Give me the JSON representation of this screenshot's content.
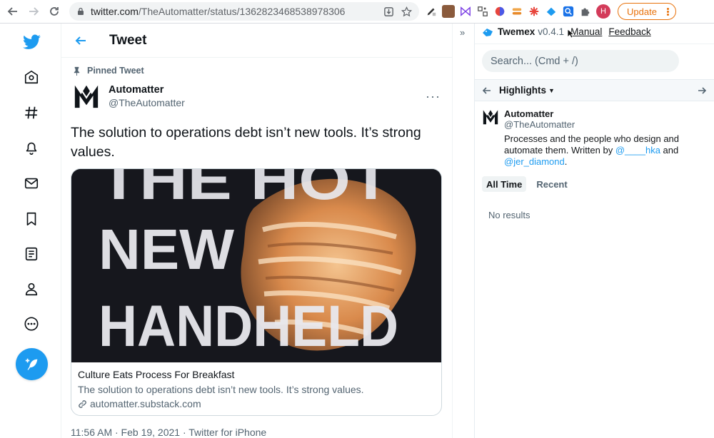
{
  "browser": {
    "url_domain": "twitter.com",
    "url_path": "/TheAutomatter/status/1362823468538978306",
    "update_label": "Update",
    "profile_initial": "H"
  },
  "twitter": {
    "header_title": "Tweet",
    "pinned_label": "Pinned Tweet",
    "author_name": "Automatter",
    "author_handle": "@TheAutomatter",
    "tweet_text": "The solution to operations debt isn’t new tools. It’s strong values.",
    "card": {
      "image_text": [
        "THE HOT",
        "NEW",
        "HANDHELD"
      ],
      "title": "Culture Eats Process For Breakfast",
      "description": "The solution to operations debt isn’t new tools. It’s strong values.",
      "domain": "automatter.substack.com"
    },
    "meta": "11:56 AM · Feb 19, 2021 · Twitter for iPhone",
    "accent": "#1d9bf0"
  },
  "twemex": {
    "collapse_label": "»",
    "name": "Twemex",
    "version": "v0.4.1",
    "manual_link": "Manual",
    "feedback_link": "Feedback",
    "search_placeholder": "Search... (Cmd + /)",
    "highlights_label": "Highlights",
    "profile": {
      "name": "Automatter",
      "handle": "@TheAutomatter",
      "bio_prefix": "Processes and the people who design and automate them. Written by ",
      "mention1": "@____hka",
      "bio_mid": " and ",
      "mention2": "@jer_diamond",
      "bio_suffix": "."
    },
    "tabs": [
      "All Time",
      "Recent"
    ],
    "no_results": "No results"
  }
}
